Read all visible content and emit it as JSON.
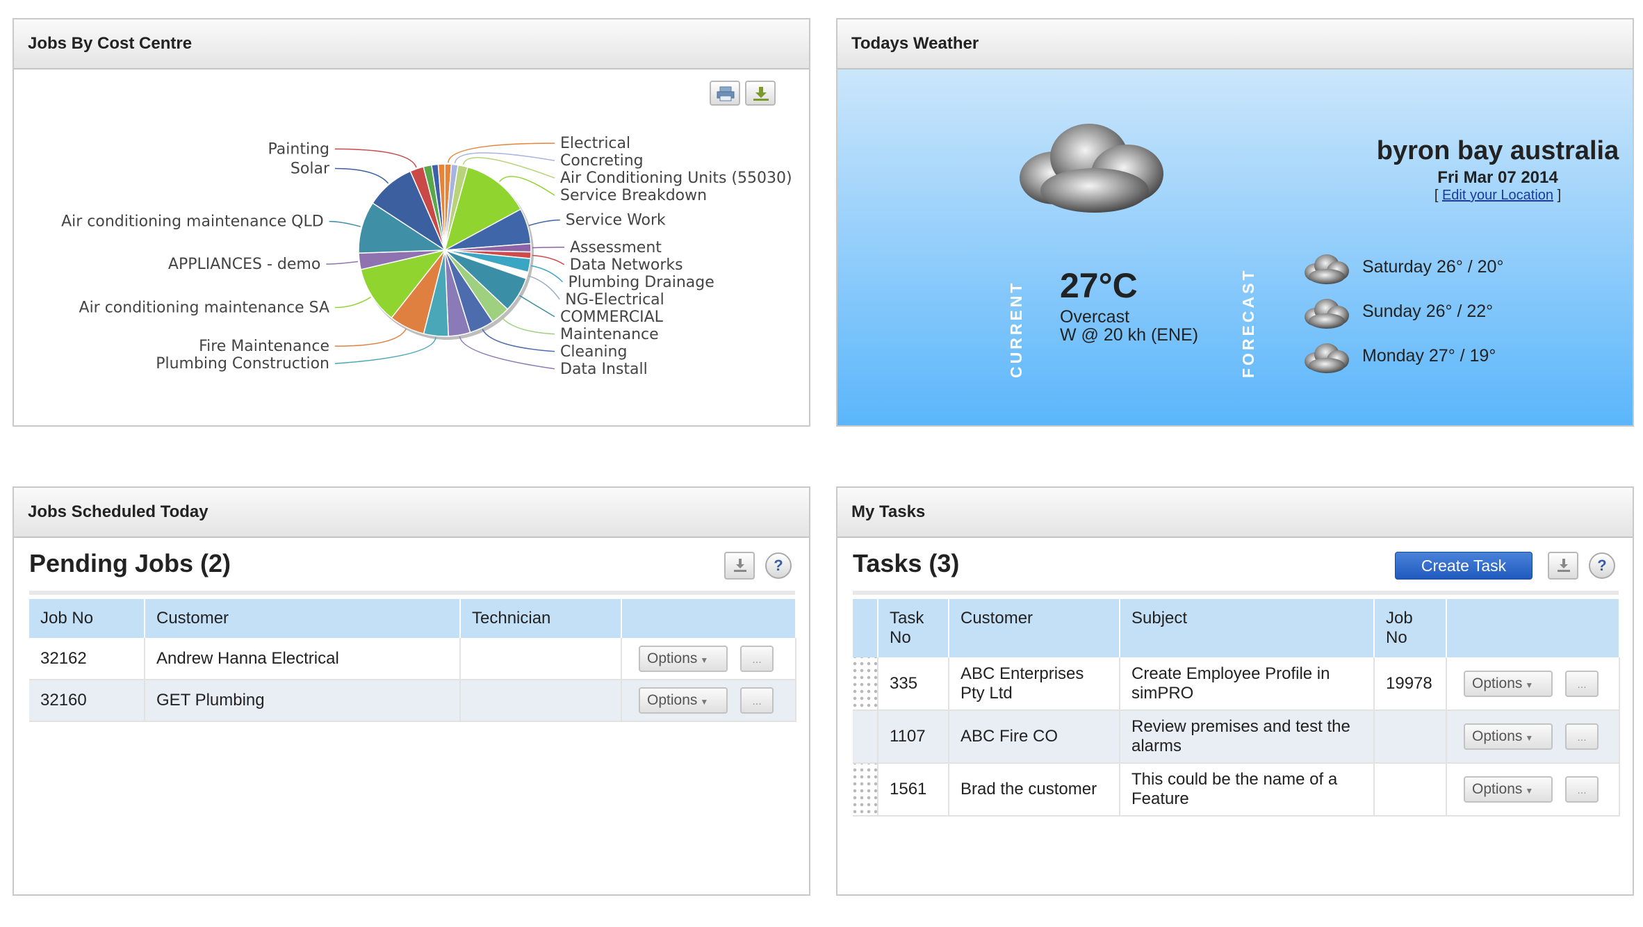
{
  "cost_panel": {
    "title": "Jobs By Cost Centre",
    "print_icon": "printer-icon",
    "download_icon": "download-icon"
  },
  "chart_data": {
    "type": "pie",
    "title": "",
    "slices": [
      {
        "label": "Electrical",
        "value": 1.2,
        "color": "#e8833a"
      },
      {
        "label": "Concreting",
        "value": 1.2,
        "color": "#a7b3e0"
      },
      {
        "label": "Air Conditioning Units (55030)",
        "value": 1.8,
        "color": "#b8d37a"
      },
      {
        "label": "Service Breakdown",
        "value": 12.5,
        "color": "#8fd42f"
      },
      {
        "label": "Service Work",
        "value": 6.5,
        "color": "#3f66a8"
      },
      {
        "label": "Assessment",
        "value": 1.5,
        "color": "#8e63a6"
      },
      {
        "label": "Data Networks",
        "value": 1.2,
        "color": "#cf4a4a"
      },
      {
        "label": "Plumbing Drainage",
        "value": 2.5,
        "color": "#3ba6c4"
      },
      {
        "label": "NG-Electrical",
        "value": 1.2,
        "color": "#ffffff"
      },
      {
        "label": "COMMERCIAL",
        "value": 6.5,
        "color": "#3a8fa6"
      },
      {
        "label": "Maintenance",
        "value": 3.5,
        "color": "#9fd07f"
      },
      {
        "label": "Cleaning",
        "value": 4.5,
        "color": "#4c6cae"
      },
      {
        "label": "Data Install",
        "value": 4.0,
        "color": "#8a7ab8"
      },
      {
        "label": "Plumbing Construction",
        "value": 4.5,
        "color": "#4aa7b8"
      },
      {
        "label": "Fire Maintenance",
        "value": 6.5,
        "color": "#e08040"
      },
      {
        "label": "Air conditioning maintenance SA",
        "value": 10.5,
        "color": "#8fd42f"
      },
      {
        "label": "APPLIANCES - demo",
        "value": 3.0,
        "color": "#8e73b0"
      },
      {
        "label": "Air conditioning maintenance QLD",
        "value": 9.5,
        "color": "#3f8fa6"
      },
      {
        "label": "Solar",
        "value": 9.0,
        "color": "#3c5fa0"
      },
      {
        "label": "Painting",
        "value": 2.5,
        "color": "#c94848"
      },
      {
        "label": "",
        "value": 1.5,
        "color": "#5ba84a"
      },
      {
        "label": "",
        "value": 1.2,
        "color": "#3f5fa8"
      },
      {
        "label": "",
        "value": 1.2,
        "color": "#e8833a"
      }
    ]
  },
  "weather": {
    "title": "Todays Weather",
    "location": "byron bay australia",
    "date": "Fri Mar 07 2014",
    "edit_open": "[",
    "edit_link": "Edit your Location",
    "edit_close": "]",
    "current_label": "CURRENT",
    "forecast_label": "FORECAST",
    "current_temp": "27°C",
    "current_desc": "Overcast",
    "current_wind": "W @ 20 kh (ENE)",
    "icon": "cloud-icon",
    "forecast": [
      {
        "text": "Saturday 26° / 20°"
      },
      {
        "text": "Sunday 26° / 22°"
      },
      {
        "text": "Monday 27° / 19°"
      }
    ]
  },
  "scheduled": {
    "title": "Jobs Scheduled Today",
    "section": "Pending Jobs (2)",
    "headers": [
      "Job No",
      "Customer",
      "Technician"
    ],
    "rows": [
      {
        "job_no": "32162",
        "customer": "Andrew Hanna Electrical",
        "technician": ""
      },
      {
        "job_no": "32160",
        "customer": "GET Plumbing",
        "technician": ""
      }
    ],
    "options_label": "Options",
    "more_label": "...",
    "help": "?"
  },
  "tasks": {
    "title": "My Tasks",
    "section": "Tasks (3)",
    "create_label": "Create Task",
    "headers": [
      "Task No",
      "Customer",
      "Subject",
      "Job No"
    ],
    "rows": [
      {
        "task_no": "335",
        "customer": "ABC Enterprises Pty Ltd",
        "subject": "Create Employee Profile in simPRO",
        "job_no": "19978"
      },
      {
        "task_no": "1107",
        "customer": "ABC Fire CO",
        "subject": "Review premises and test the alarms",
        "job_no": ""
      },
      {
        "task_no": "1561",
        "customer": "Brad the customer",
        "subject": "This could be the name of a Feature",
        "job_no": ""
      }
    ],
    "options_label": "Options",
    "more_label": "...",
    "help": "?"
  }
}
